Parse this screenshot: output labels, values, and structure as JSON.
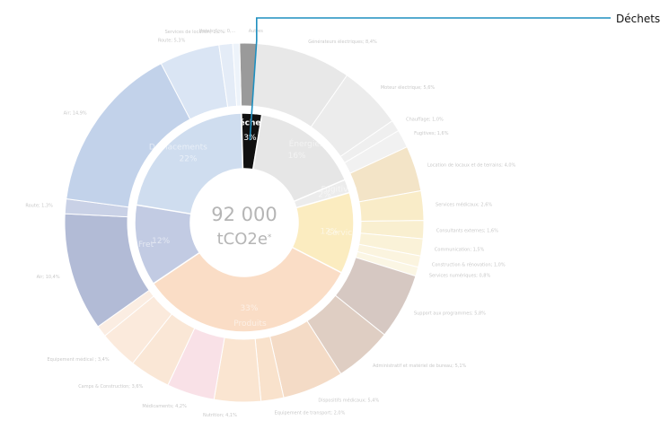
{
  "chart_data": {
    "type": "sunburst",
    "total": {
      "value": "92 000",
      "unit": "tCO2e",
      "unit_mark": "*"
    },
    "inner": [
      {
        "name": "Déchets",
        "value": 3,
        "label": "3%",
        "color": "#111111",
        "highlight": true
      },
      {
        "name": "Énergies",
        "value": 16,
        "label": "16%",
        "color": "#c4c4c4"
      },
      {
        "name": "Fugitives",
        "value": 2,
        "label": "2%",
        "color": "#d4d4d4"
      },
      {
        "name": "Services",
        "value": 12,
        "label": "12%",
        "color": "#f7d26a"
      },
      {
        "name": "Produits",
        "value": 33,
        "label": "33%",
        "color": "#f5b07a"
      },
      {
        "name": "Fret",
        "value": 12,
        "label": "12%",
        "color": "#6f86bd"
      },
      {
        "name": "Déplacements",
        "value": 22,
        "label": "22%",
        "color": "#8fb0da"
      }
    ],
    "outer": [
      {
        "label": "Autres",
        "value": 1.5,
        "color": "#111111"
      },
      {
        "label": "Générateurs électriques; 8,4%",
        "value": 8.4,
        "color": "#c9c9c9"
      },
      {
        "label": "Moteur électrique; 5,6%",
        "value": 5.6,
        "color": "#d2d2d2"
      },
      {
        "label": "Chauffage; 1,0%",
        "value": 1.0,
        "color": "#dadada"
      },
      {
        "label": "Fugitives; 1,6%",
        "value": 1.6,
        "color": "#e0e0e0"
      },
      {
        "label": "Location de locaux et de terrains; 4,0%",
        "value": 4.0,
        "color": "#e3c07c"
      },
      {
        "label": "Services médicaux; 2,6%",
        "value": 2.6,
        "color": "#f1d37e"
      },
      {
        "label": "Consultants externes; 1,6%",
        "value": 1.6,
        "color": "#f3da90"
      },
      {
        "label": "Communication; 1,5%",
        "value": 1.5,
        "color": "#f5e1a3"
      },
      {
        "label": "Construction & rénovation; 1,0%",
        "value": 1.0,
        "color": "#f6e6b5"
      },
      {
        "label": "Services numériques; 0,8%",
        "value": 0.8,
        "color": "#f7eac0"
      },
      {
        "label": "Support aux programmes; 5,8%",
        "value": 5.8,
        "color": "#9f7e6f"
      },
      {
        "label": "Administratif et matériel de bureau; 5,1%",
        "value": 5.1,
        "color": "#b58c71"
      },
      {
        "label": "Dispositifs médicaux; 5,4%",
        "value": 5.4,
        "color": "#e7aa78"
      },
      {
        "label": "Equipement de transport; 2,0%",
        "value": 2.0,
        "color": "#f2bc88"
      },
      {
        "label": "Nutrition; 4,1%",
        "value": 4.1,
        "color": "#f4c294"
      },
      {
        "label": "Médicaments; 4,2%",
        "value": 4.2,
        "color": "#f2b9c7"
      },
      {
        "label": "Camps & Construction; 3,6%",
        "value": 3.6,
        "color": "#f5c7a0"
      },
      {
        "label": "Equipement médical ; 3,4%",
        "value": 3.4,
        "color": "#f6ceae"
      },
      {
        "label": "",
        "value": 1.0,
        "color": "#f7d6bb"
      },
      {
        "label": "Air; 10,4%",
        "value": 10.4,
        "color": "#4a5e9e"
      },
      {
        "label": "Route; 1,3%",
        "value": 1.3,
        "color": "#7f93c6"
      },
      {
        "label": "Air; 14,9%",
        "value": 14.9,
        "color": "#6f95cf"
      },
      {
        "label": "Route; 5,3%",
        "value": 5.3,
        "color": "#a8c3e6"
      },
      {
        "label": "Services de location; 1,2%",
        "value": 1.2,
        "color": "#c1d4ee"
      },
      {
        "label": "Hotels & ...; 0,...",
        "value": 0.6,
        "color": "#d6e3f4"
      }
    ],
    "callout": {
      "label": "Déchets"
    }
  }
}
